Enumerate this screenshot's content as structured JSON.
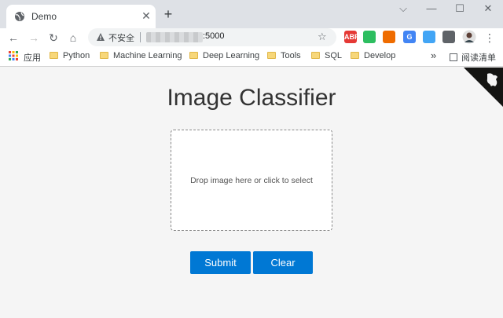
{
  "tab": {
    "title": "Demo",
    "close": "✕",
    "new_tab": "+"
  },
  "window": {
    "minimize": "—",
    "maximize": "☐",
    "close": "✕",
    "chevron": "⌵"
  },
  "toolbar": {
    "back": "←",
    "forward": "→",
    "reload": "↻",
    "home": "⌂",
    "insecure_label": "不安全",
    "url_port": ":5000",
    "bookmark_star": "☆",
    "menu": "⋮",
    "extensions": [
      {
        "name": "abp-icon",
        "label": "ABP",
        "color": "#e53935"
      },
      {
        "name": "evernote-icon",
        "label": "",
        "color": "#2dbe60"
      },
      {
        "name": "tree-icon",
        "label": "",
        "color": "#ef6c00"
      },
      {
        "name": "translate-icon",
        "label": "G",
        "color": "#4285f4"
      },
      {
        "name": "pen-icon",
        "label": "",
        "color": "#42a5f5"
      },
      {
        "name": "puzzle-icon",
        "label": "",
        "color": "#5f6368"
      }
    ]
  },
  "bookmarks": {
    "apps_label": "应用",
    "items": [
      "Python",
      "Machine Learning",
      "Deep Learning",
      "Tools",
      "SQL",
      "Develop"
    ],
    "more": "»",
    "reading_list": "阅读清单"
  },
  "page": {
    "title": "Image Classifier",
    "dropzone_text": "Drop image here or click to select",
    "submit_label": "Submit",
    "clear_label": "Clear"
  },
  "colors": {
    "accent": "#0078d4",
    "page_bg": "#f5f5f5"
  }
}
